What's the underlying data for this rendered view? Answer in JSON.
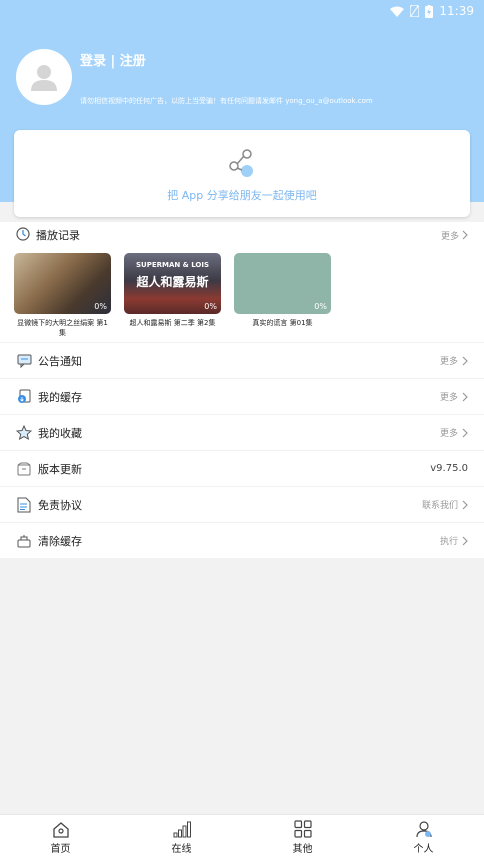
{
  "status_bar": {
    "time": "11:39"
  },
  "profile": {
    "login_label": "登录 | 注册",
    "notice": "请勿相信视频中的任何广告，以防上当受骗！有任何问题请发邮件 yong_ou_a@outlook.com"
  },
  "share": {
    "text": "把 App 分享给朋友一起使用吧"
  },
  "history": {
    "title": "播放记录",
    "more": "更多",
    "items": [
      {
        "title": "显微镜下的大明之丝绢案 第1集",
        "progress": "0%"
      },
      {
        "title": "超人和露易斯 第二季 第2集",
        "progress": "0%",
        "overlay_small": "SUPERMAN & LOIS",
        "overlay_big": "超人和露易斯"
      },
      {
        "title": "真实的谎言 第01集",
        "progress": "0%"
      }
    ]
  },
  "menu": [
    {
      "label": "公告通知",
      "right": "更多",
      "icon": "announcement-icon"
    },
    {
      "label": "我的缓存",
      "right": "更多",
      "icon": "download-icon"
    },
    {
      "label": "我的收藏",
      "right": "更多",
      "icon": "star-icon"
    },
    {
      "label": "版本更新",
      "right": "v9.75.0",
      "icon": "update-icon"
    },
    {
      "label": "免责协议",
      "right": "联系我们",
      "icon": "document-icon"
    },
    {
      "label": "清除缓存",
      "right": "执行",
      "icon": "clear-cache-icon"
    }
  ],
  "nav": [
    {
      "label": "首页",
      "icon": "home-icon"
    },
    {
      "label": "在线",
      "icon": "signal-icon"
    },
    {
      "label": "其他",
      "icon": "grid-icon"
    },
    {
      "label": "个人",
      "icon": "person-icon"
    }
  ],
  "colors": {
    "header_bg": "#a3d3fb",
    "accent": "#7cb7f0"
  }
}
